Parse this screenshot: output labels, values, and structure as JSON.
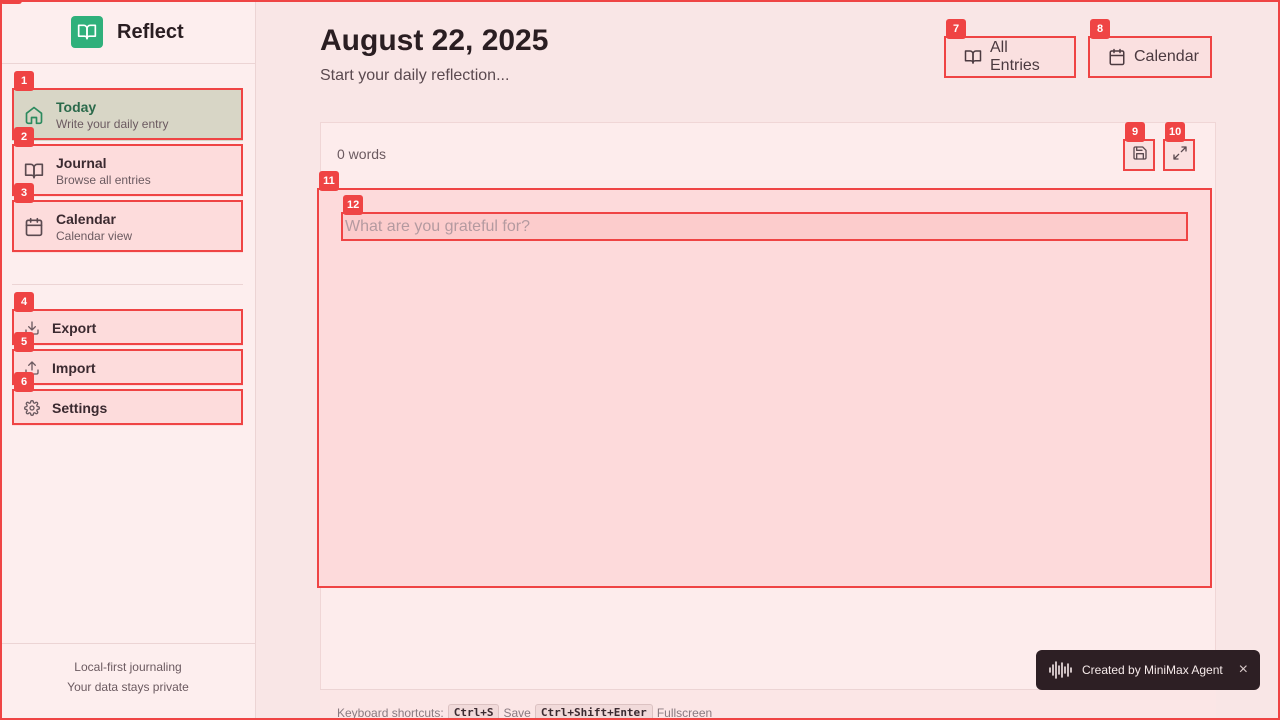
{
  "app": {
    "name": "Reflect"
  },
  "nav": [
    {
      "label": "Today",
      "sub": "Write your daily entry",
      "icon": "home-icon",
      "active": true
    },
    {
      "label": "Journal",
      "sub": "Browse all entries",
      "icon": "book-open-icon"
    },
    {
      "label": "Calendar",
      "sub": "Calendar view",
      "icon": "calendar-icon"
    }
  ],
  "tools": [
    {
      "label": "Export",
      "icon": "download-icon"
    },
    {
      "label": "Import",
      "icon": "upload-icon"
    },
    {
      "label": "Settings",
      "icon": "gear-icon"
    }
  ],
  "sidebar_footer": {
    "line1": "Local-first journaling",
    "line2": "Your data stays private"
  },
  "header": {
    "date": "August 22, 2025",
    "subtitle": "Start your daily reflection...",
    "all_entries_label": "All Entries",
    "calendar_label": "Calendar"
  },
  "editor": {
    "word_count": "0 words",
    "placeholder": "What are you grateful for?",
    "value": ""
  },
  "shortcuts": {
    "prefix": "Keyboard shortcuts:",
    "save_key": "Ctrl+S",
    "save_label": "Save",
    "fullscreen_key": "Ctrl+Shift+Enter",
    "fullscreen_label": "Fullscreen"
  },
  "toast": {
    "text": "Created by MiniMax Agent",
    "close": "×"
  },
  "som_labels": [
    "1",
    "2",
    "3",
    "4",
    "5",
    "6",
    "7",
    "8",
    "9",
    "10",
    "11",
    "12"
  ],
  "colors": {
    "brand": "#2fb07b",
    "marker": "#ef4444",
    "active_nav": "#d8d6c6",
    "active_text": "#2b6a4b"
  }
}
